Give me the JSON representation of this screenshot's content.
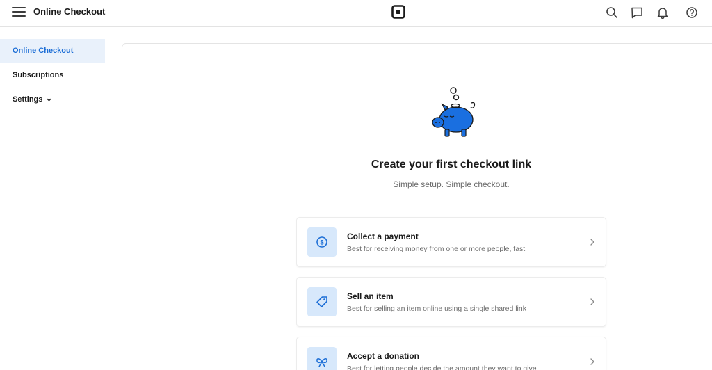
{
  "header": {
    "title": "Online Checkout",
    "brand_icon": "square-logo",
    "icons": [
      "search-icon",
      "messages-icon",
      "notifications-icon",
      "help-icon"
    ]
  },
  "sidebar": {
    "items": [
      {
        "label": "Online Checkout",
        "active": true
      },
      {
        "label": "Subscriptions",
        "active": false
      },
      {
        "label": "Settings",
        "active": false,
        "expandable": true
      }
    ]
  },
  "main": {
    "illustration": "piggy-bank-illustration",
    "headline": "Create your first checkout link",
    "subline": "Simple setup. Simple checkout.",
    "options": [
      {
        "icon": "dollar-coin-icon",
        "title": "Collect a payment",
        "description": "Best for receiving money from one or more people, fast"
      },
      {
        "icon": "price-tag-icon",
        "title": "Sell an item",
        "description": "Best for selling an item online using a single shared link"
      },
      {
        "icon": "ribbon-icon",
        "title": "Accept a donation",
        "description": "Best for letting people decide the amount they want to give"
      }
    ]
  },
  "colors": {
    "accent": "#1c6ed6",
    "active_bg": "#e9f1fb",
    "icon_box_bg": "#d7e8fb",
    "illustration_blue": "#1a6fe0"
  }
}
